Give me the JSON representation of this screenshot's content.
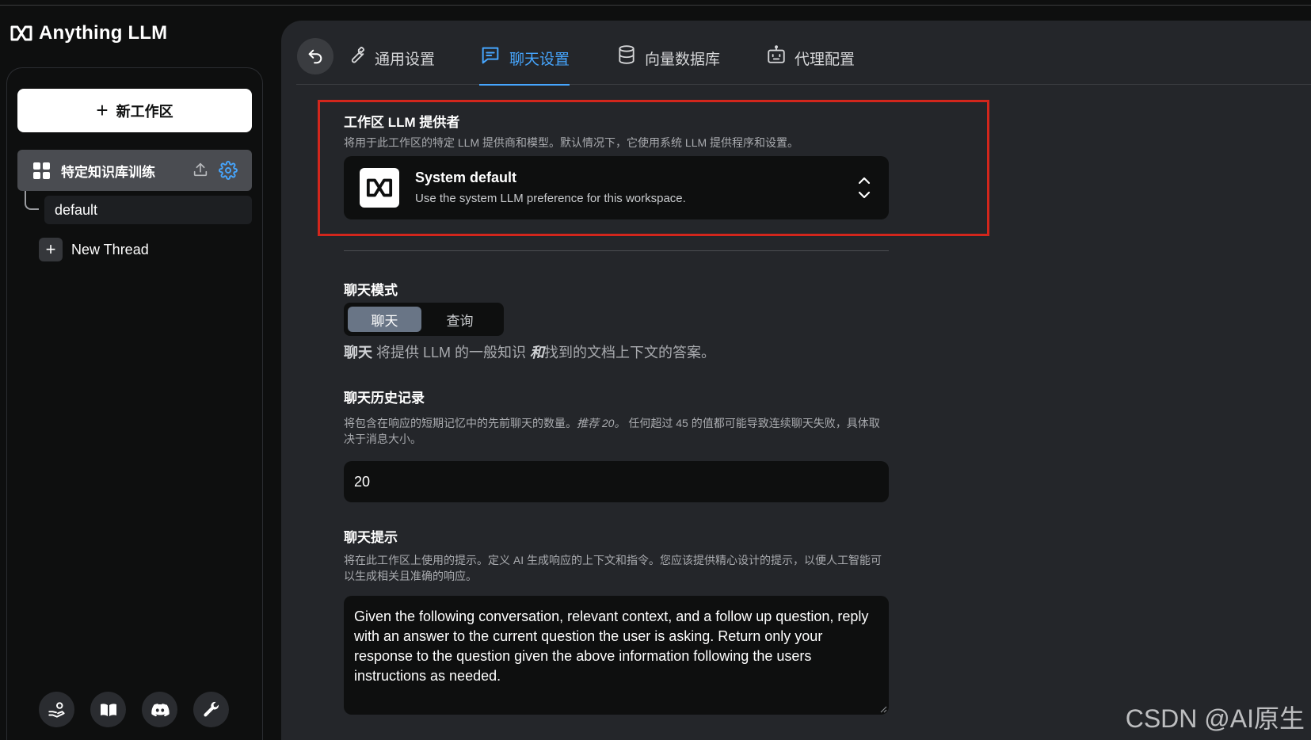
{
  "app": {
    "brand": "Anything LLM"
  },
  "sidebar": {
    "new_workspace_label": "新工作区",
    "workspace": {
      "name": "特定知识库训练"
    },
    "threads": [
      {
        "label": "default"
      }
    ],
    "new_thread_label": "New Thread",
    "footer_icons": [
      "community-hub-icon",
      "docs-book-icon",
      "discord-icon",
      "wrench-settings-icon"
    ]
  },
  "tabs": [
    {
      "label": "通用设置",
      "icon": "wrench-icon",
      "active": false
    },
    {
      "label": "聊天设置",
      "icon": "chat-icon",
      "active": true
    },
    {
      "label": "向量数据库",
      "icon": "database-icon",
      "active": false
    },
    {
      "label": "代理配置",
      "icon": "robot-icon",
      "active": false
    }
  ],
  "llm_provider": {
    "title": "工作区 LLM 提供者",
    "description": "将用于此工作区的特定 LLM 提供商和模型。默认情况下，它使用系统 LLM 提供程序和设置。",
    "selected_name": "System default",
    "selected_desc": "Use the system LLM preference for this workspace."
  },
  "chat_mode": {
    "title": "聊天模式",
    "options": [
      "聊天",
      "查询"
    ],
    "selected": "聊天",
    "desc_bold": "聊天",
    "desc_part1": " 将提供 LLM 的一般知识 ",
    "desc_italic": "和",
    "desc_part2": "找到的文档上下文的答案。"
  },
  "chat_history": {
    "title": "聊天历史记录",
    "desc_part1": "将包含在响应的短期记忆中的先前聊天的数量。",
    "desc_italic": "推荐 20。",
    "desc_part2": " 任何超过 45 的值都可能导致连续聊天失败，具体取决于消息大小。",
    "value": "20"
  },
  "chat_prompt": {
    "title": "聊天提示",
    "description": "将在此工作区上使用的提示。定义 AI 生成响应的上下文和指令。您应该提供精心设计的提示，以便人工智能可以生成相关且准确的响应。",
    "value": "Given the following conversation, relevant context, and a follow up question, reply with an answer to the current question the user is asking. Return only your response to the question given the above information following the users instructions as needed."
  },
  "watermark": "CSDN @AI原生",
  "colors": {
    "accent": "#46a6ff",
    "highlight": "#d2261c",
    "panel": "#24262a",
    "background": "#0e0f0f"
  }
}
